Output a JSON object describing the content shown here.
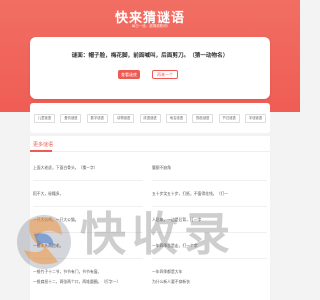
{
  "header": {
    "title": "快来猜谜语",
    "slogan": "每日一谜，越猜越聪明!"
  },
  "riddle": {
    "text": "谜面：帽子脸，梅花脚，前面喊叫，后面剪刀。（猜一动物名）",
    "show_answer_label": "查看谜底",
    "next_label": "再来一个"
  },
  "categories": [
    "儿童谜语",
    "爱情谜语",
    "数字谜语",
    "动物谜语",
    "成语谜语",
    "地名谜语",
    "物品谜语",
    "节日谜语",
    "字谜谜语"
  ],
  "more": {
    "title": "更多谜语",
    "items_left": [
      "上面大老虎，下面白骨头。（猜一字）",
      "稻不大，秘籍多。",
      "一只大公鸡，一只大公猫。",
      "一根木头两边毛。",
      "一根竹子十二节，节节有门，节节有窗。",
      "一根扁担十二，两张两个口，两堆圆圈。（打字一）"
    ],
    "items_right": [
      "腰颤不缺角",
      "五十步笑五十步，打纸，不值得花钱。（打一",
      "人后来，一边是后背，打一字",
      "一年四季总是走，打一个字",
      "一年四季都是大年",
      "为什么新人要不穿新衣"
    ]
  },
  "watermark": {
    "text": "快收录"
  },
  "colors": {
    "brand": "#ef5b52",
    "background": "#f3f3f3"
  }
}
